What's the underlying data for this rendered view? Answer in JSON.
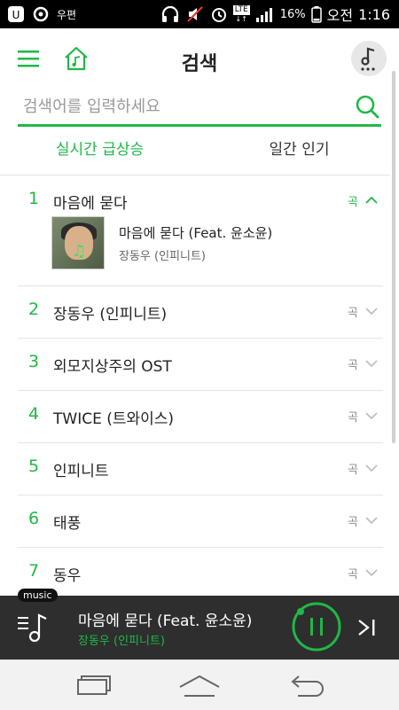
{
  "status_bar": {
    "carrier": "우편",
    "battery_percent": "16%",
    "ampm": "오전",
    "time": "1:16",
    "network": "LTE"
  },
  "header": {
    "title": "검색"
  },
  "search": {
    "placeholder": "검색어를 입력하세요"
  },
  "tabs": [
    {
      "label": "실시간 급상승",
      "active": true
    },
    {
      "label": "일간 인기",
      "active": false
    }
  ],
  "results": [
    {
      "rank": "1",
      "name": "마음에 묻다",
      "kind": "곡",
      "expanded": true,
      "song": {
        "title": "마음에 묻다 (Feat. 윤소윤)",
        "artist": "장동우 (인피니트)"
      }
    },
    {
      "rank": "2",
      "name": "장동우 (인피니트)",
      "kind": "곡"
    },
    {
      "rank": "3",
      "name": "외모지상주의 OST",
      "kind": "곡"
    },
    {
      "rank": "4",
      "name": "TWICE (트와이스)",
      "kind": "곡"
    },
    {
      "rank": "5",
      "name": "인피니트",
      "kind": "곡"
    },
    {
      "rank": "6",
      "name": "태풍",
      "kind": "곡"
    },
    {
      "rank": "7",
      "name": "동우",
      "kind": "곡"
    }
  ],
  "mini_player": {
    "badge": "music",
    "title": "마음에 묻다 (Feat. 윤소윤)",
    "artist": "장동우 (인피니트)"
  },
  "colors": {
    "accent": "#1fb846",
    "player_bg": "#2e2e2e"
  }
}
